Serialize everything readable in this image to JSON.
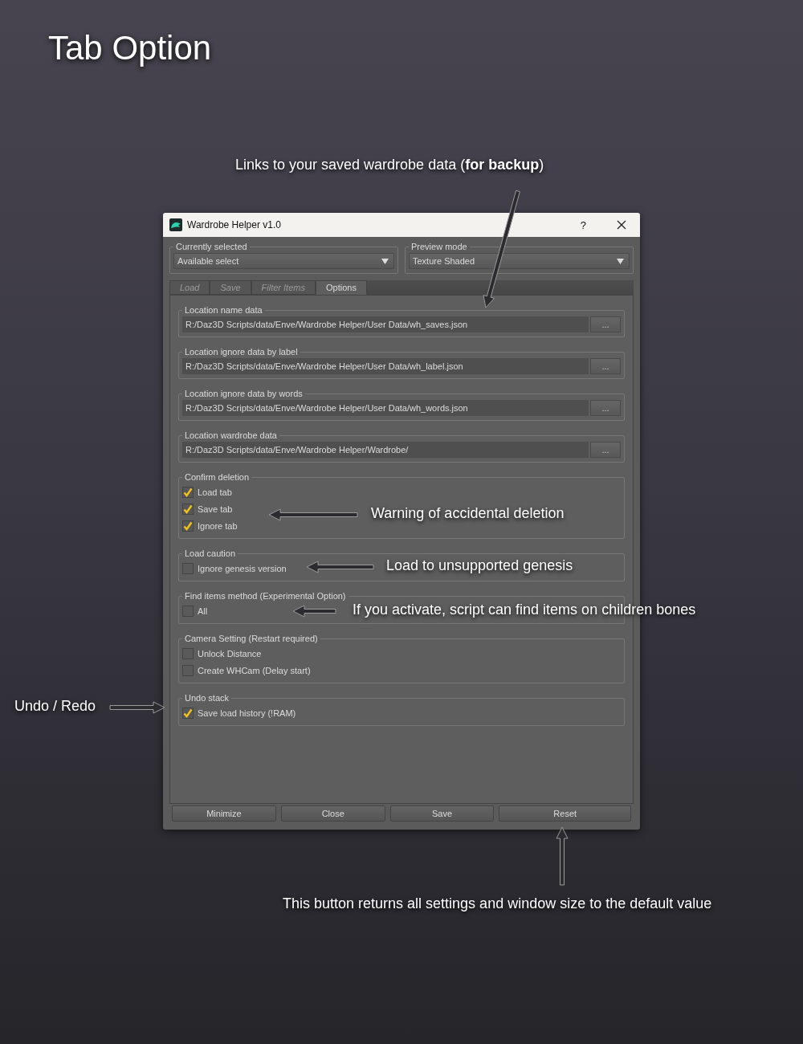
{
  "title": "Tab Option",
  "window": {
    "title": "Wardrobe Helper v1.0",
    "help": "?"
  },
  "selectors": [
    {
      "label": "Currently selected",
      "value": "Available select"
    },
    {
      "label": "Preview mode",
      "value": "Texture Shaded"
    }
  ],
  "tabs": [
    {
      "label": "Load",
      "selected": false,
      "disabled": true
    },
    {
      "label": "Save",
      "selected": false,
      "disabled": true
    },
    {
      "label": "Filter Items",
      "selected": false,
      "disabled": true
    },
    {
      "label": "Options",
      "selected": true,
      "disabled": false
    }
  ],
  "paths": [
    {
      "label": "Location name data",
      "value": "R:/Daz3D Scripts/data/Enve/Wardrobe Helper/User Data/wh_saves.json",
      "button": "..."
    },
    {
      "label": "Location ignore data by label",
      "value": "R:/Daz3D Scripts/data/Enve/Wardrobe Helper/User Data/wh_label.json",
      "button": "..."
    },
    {
      "label": "Location ignore data by words",
      "value": "R:/Daz3D Scripts/data/Enve/Wardrobe Helper/User Data/wh_words.json",
      "button": "..."
    },
    {
      "label": "Location wardrobe data",
      "value": "R:/Daz3D Scripts/data/Enve/Wardrobe Helper/Wardrobe/",
      "button": "..."
    }
  ],
  "groups": [
    {
      "label": "Confirm deletion",
      "options": [
        {
          "label": "Load tab",
          "checked": true
        },
        {
          "label": "Save tab",
          "checked": true
        },
        {
          "label": "Ignore tab",
          "checked": true
        }
      ]
    },
    {
      "label": "Load caution",
      "options": [
        {
          "label": "Ignore genesis version",
          "checked": false
        }
      ]
    },
    {
      "label": "Find items method (Experimental Option)",
      "options": [
        {
          "label": "All",
          "checked": false
        }
      ]
    },
    {
      "label": "Camera Setting (Restart required)",
      "options": [
        {
          "label": "Unlock Distance",
          "checked": false
        },
        {
          "label": "Create WHCam (Delay start)",
          "checked": false
        }
      ]
    },
    {
      "label": "Undo stack",
      "options": [
        {
          "label": "Save load history (!RAM)",
          "checked": true
        }
      ]
    }
  ],
  "buttons": [
    "Minimize",
    "Close",
    "Save",
    "Reset"
  ],
  "callouts": [
    "Links to your saved wardrobe data (**for backup**)",
    "Warning of accidental deletion",
    "Load to unsupported genesis",
    "If you activate, script can find items on children bones",
    "Undo / Redo",
    "This button returns all settings and window size to the default value"
  ]
}
